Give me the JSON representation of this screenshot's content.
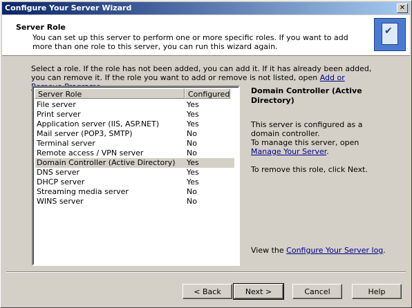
{
  "window": {
    "title": "Configure Your Server Wizard",
    "close_label": "✕"
  },
  "header": {
    "title": "Server Role",
    "description": "You can set up this server to perform one or more specific roles. If you want to add more than one role to this server, you can run this wizard again."
  },
  "intro": {
    "text": "Select a role. If the role has not been added, you can add it. If it has already been added, you can remove it. If the role you want to add or remove is not listed, open ",
    "link": "Add or Remove Programs",
    "end": "."
  },
  "table": {
    "columns": [
      "Server Role",
      "Configured"
    ],
    "rows": [
      [
        "File server",
        "Yes"
      ],
      [
        "Print server",
        "Yes"
      ],
      [
        "Application server (IIS, ASP.NET)",
        "Yes"
      ],
      [
        "Mail server (POP3, SMTP)",
        "No"
      ],
      [
        "Terminal server",
        "No"
      ],
      [
        "Remote access / VPN server",
        "No"
      ],
      [
        "Domain Controller (Active Directory)",
        "Yes"
      ],
      [
        "DNS server",
        "Yes"
      ],
      [
        "DHCP server",
        "Yes"
      ],
      [
        "Streaming media server",
        "No"
      ],
      [
        "WINS server",
        "No"
      ]
    ],
    "selected_index": 6
  },
  "details": {
    "title": "Domain Controller (Active Directory)",
    "configured_text": "This server is configured as a domain controller.",
    "manage_prefix": "To manage this server, open ",
    "manage_link": "Manage Your Server",
    "manage_suffix": ".",
    "remove_text": "To remove this role, click Next.",
    "log_prefix": "View the ",
    "log_link": "Configure Your Server log",
    "log_suffix": "."
  },
  "buttons": {
    "back": "< Back",
    "next": "Next >",
    "cancel": "Cancel",
    "help": "Help"
  }
}
